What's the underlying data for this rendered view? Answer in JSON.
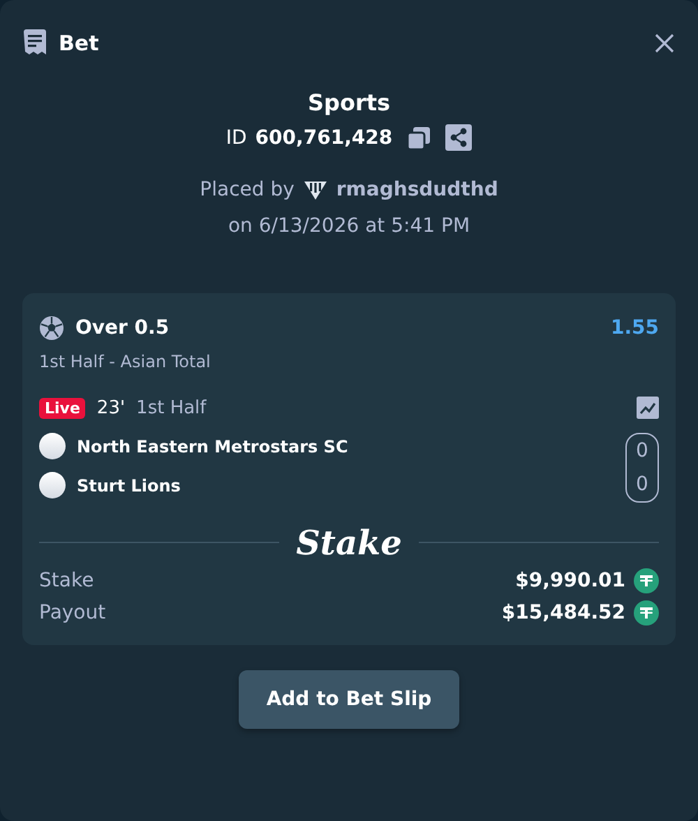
{
  "header": {
    "title": "Bet"
  },
  "summary": {
    "category": "Sports",
    "id_label": "ID",
    "id_value": "600,761,428",
    "placed_by_label": "Placed by",
    "username": "rmaghsdudthd",
    "placed_on": "on 6/13/2026 at 5:41 PM"
  },
  "selection": {
    "outcome": "Over 0.5",
    "odds": "1.55",
    "market": "1st Half - Asian Total"
  },
  "match": {
    "live_badge": "Live",
    "minute": "23'",
    "period": "1st Half",
    "teams": [
      {
        "name": "North Eastern Metrostars SC",
        "score": "0"
      },
      {
        "name": "Sturt Lions",
        "score": "0"
      }
    ]
  },
  "brand": "Stake",
  "amounts": [
    {
      "label": "Stake",
      "value": "$9,990.01"
    },
    {
      "label": "Payout",
      "value": "$15,484.52"
    }
  ],
  "action": {
    "label": "Add to Bet Slip"
  }
}
